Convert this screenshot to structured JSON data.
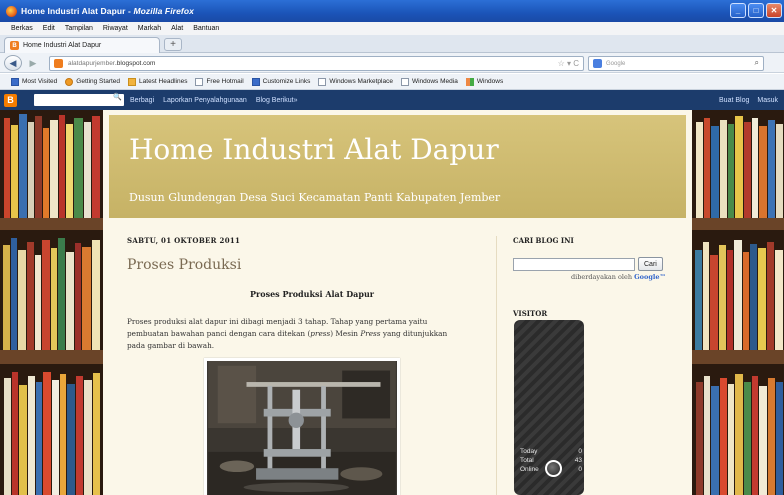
{
  "window": {
    "title_main": "Home Industri Alat Dapur",
    "title_sep": " - ",
    "title_app": "Mozilla Firefox",
    "minimize": "_",
    "maximize": "□",
    "close": "✕"
  },
  "menu": [
    "Berkas",
    "Edit",
    "Tampilan",
    "Riwayat",
    "Markah",
    "Alat",
    "Bantuan"
  ],
  "tab": {
    "label": "Home Industri Alat Dapur",
    "new_tab": "+"
  },
  "nav": {
    "url_domain": "alatdapurjember",
    "url_rest": ".blogspot.com",
    "url_controls": "☆ ▾ C",
    "search_placeholder": "Google"
  },
  "bookmarks": [
    {
      "label": "Most Visited",
      "icon": "folder-icon"
    },
    {
      "label": "Getting Started",
      "icon": "firefox-icon"
    },
    {
      "label": "Latest Headlines",
      "icon": "rss-icon"
    },
    {
      "label": "Free Hotmail",
      "icon": "page-icon"
    },
    {
      "label": "Customize Links",
      "icon": "page-icon"
    },
    {
      "label": "Windows Marketplace",
      "icon": "page-icon"
    },
    {
      "label": "Windows Media",
      "icon": "page-icon"
    },
    {
      "label": "Windows",
      "icon": "windows-icon"
    }
  ],
  "blogger_bar": {
    "logo": "B",
    "links": [
      "Berbagi",
      "Laporkan Penyalahgunaan",
      "Blog Berikut»"
    ],
    "right": [
      "Buat Blog",
      "Masuk"
    ]
  },
  "blog": {
    "title": "Home Industri Alat Dapur",
    "description": "Dusun Glundengan Desa Suci Kecamatan Panti Kabupaten Jember"
  },
  "post": {
    "date": "SABTU, 01 OKTOBER 2011",
    "title": "Proses Produksi",
    "subtitle": "Proses Produksi Alat Dapur",
    "body_1": "Proses produksi alat dapur ini dibagi menjadi 3 tahap. Tahap yang pertama yaitu pembuatan bawahan panci dengan cara ditekan (",
    "body_italic_1": "press",
    "body_2": ") Mesin ",
    "body_italic_2": "Press",
    "body_3": " yang ditunjukkan pada gambar di bawah."
  },
  "sidebar": {
    "search_title": "CARI BLOG INI",
    "search_button": "Cari",
    "powered_prefix": "diberdayakan oleh ",
    "powered_brand": "Google™",
    "visitor_title": "VISITOR",
    "counter": [
      {
        "label": "Today",
        "value": "0"
      },
      {
        "label": "Total",
        "value": "43"
      },
      {
        "label": "Online",
        "value": "0"
      }
    ]
  },
  "colors": {
    "header_gold": "#c8b56a",
    "page_cream": "#fbf7e9",
    "blogger_navy": "#1c3c6c",
    "post_title": "#7a6a52"
  }
}
